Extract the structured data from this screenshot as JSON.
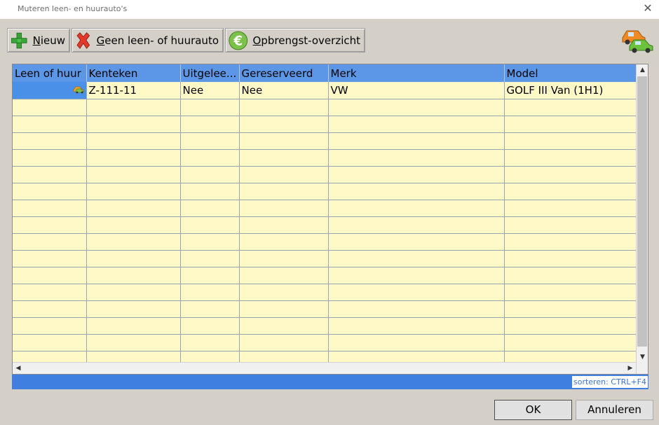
{
  "window": {
    "title": "Muteren leen- en huurauto's"
  },
  "toolbar": {
    "new_label": "Nieuw",
    "new_accel": "N",
    "none_label": "Geen leen- of huurauto",
    "none_accel": "G",
    "revenue_label": "Opbrengst-overzicht",
    "revenue_accel": "O"
  },
  "grid": {
    "columns": [
      "Leen of huur",
      "Kenteken",
      "Uitgelee...",
      "Gereserveerd",
      "Merk",
      "Model"
    ],
    "rows": [
      {
        "type_icon": "car-icon",
        "kenteken": "Z-111-11",
        "uitgeleend": "Nee",
        "gereserveerd": "Nee",
        "merk": "VW",
        "model": "GOLF III Van (1H1)"
      }
    ],
    "empty_rows": 16
  },
  "status": {
    "hint": "sorteren: CTRL+F4"
  },
  "buttons": {
    "ok": "OK",
    "cancel": "Annuleren"
  },
  "colors": {
    "header": "#5b97e6",
    "grid_bg": "#fff8c7",
    "selected_cell": "#4a90e8",
    "statusbar": "#3f7fe0"
  }
}
